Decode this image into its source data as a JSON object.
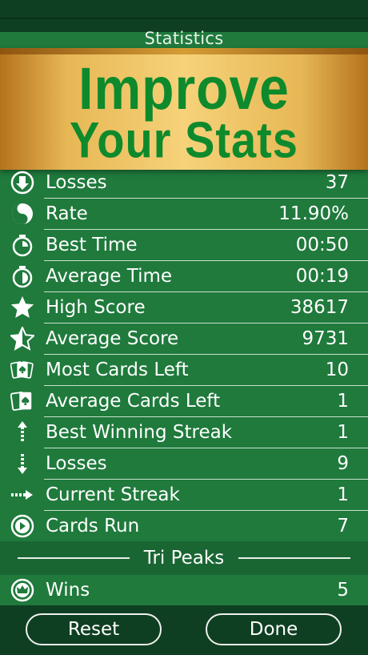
{
  "header": {
    "title": "Statistics"
  },
  "banner": {
    "line1": "Improve",
    "line2": "Your Stats"
  },
  "rows": [
    {
      "icon": "down-arrow-circle-icon",
      "label": "Losses",
      "value": "37"
    },
    {
      "icon": "yin-yang-icon",
      "label": "Rate",
      "value": "11.90%"
    },
    {
      "icon": "stopwatch-icon",
      "label": "Best Time",
      "value": "00:50"
    },
    {
      "icon": "stopwatch-half-icon",
      "label": "Average Time",
      "value": "00:19"
    },
    {
      "icon": "star-icon",
      "label": "High Score",
      "value": "38617"
    },
    {
      "icon": "half-star-icon",
      "label": "Average Score",
      "value": "9731"
    },
    {
      "icon": "cards-icon",
      "label": "Most Cards Left",
      "value": "10"
    },
    {
      "icon": "cards-half-icon",
      "label": "Average Cards Left",
      "value": "1"
    },
    {
      "icon": "up-arrow-icon",
      "label": "Best Winning Streak",
      "value": "1"
    },
    {
      "icon": "down-arrow-icon",
      "label": "Losses",
      "value": "9"
    },
    {
      "icon": "right-arrow-icon",
      "label": "Current Streak",
      "value": "1"
    },
    {
      "icon": "play-circle-icon",
      "label": "Cards Run",
      "value": "7"
    }
  ],
  "section": {
    "title": "Tri Peaks"
  },
  "wins": {
    "icon": "crown-circle-icon",
    "label": "Wins",
    "value": "5"
  },
  "buttons": {
    "reset": "Reset",
    "done": "Done"
  },
  "colors": {
    "felt": "#1f7a3c",
    "dark": "#0f3f22",
    "banner_gold": "#f6d27a",
    "banner_text": "#0e8a2c"
  }
}
